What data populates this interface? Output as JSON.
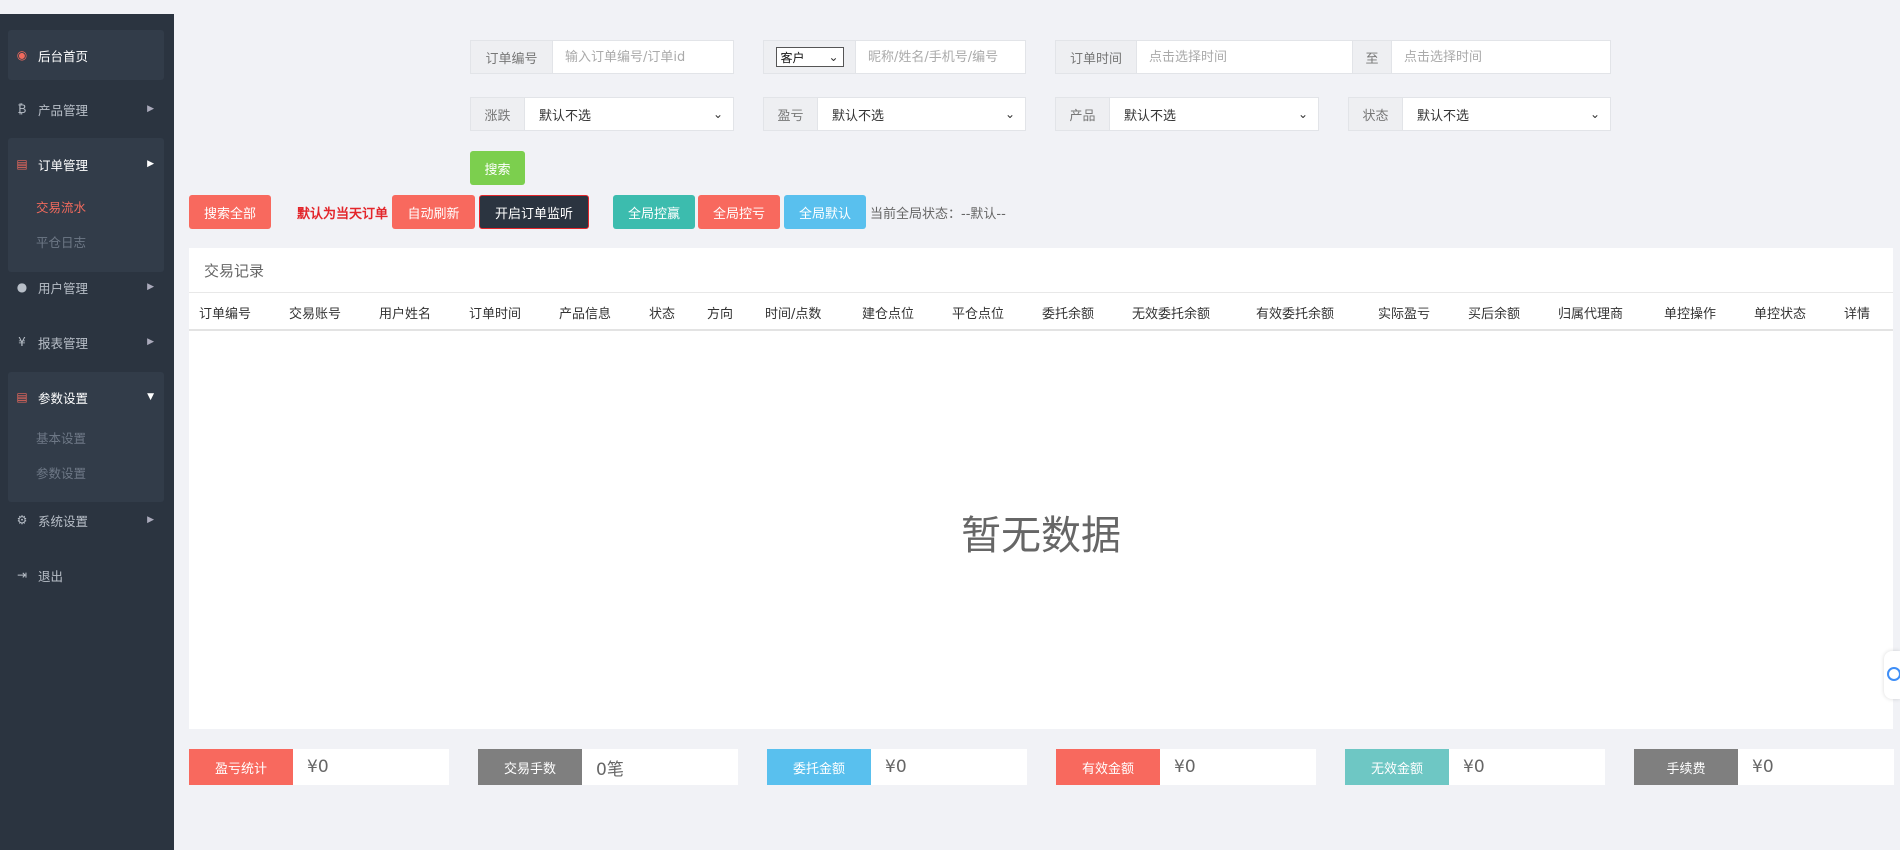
{
  "sidebar": {
    "items": [
      {
        "label": "后台首页",
        "icon": "dashboard-icon"
      },
      {
        "label": "产品管理",
        "icon": "bitcoin-icon"
      },
      {
        "label": "订单管理",
        "icon": "copy-icon"
      },
      {
        "label": "用户管理",
        "icon": "user-icon"
      },
      {
        "label": "报表管理",
        "icon": "yen-icon"
      },
      {
        "label": "参数设置",
        "icon": "copy-icon"
      },
      {
        "label": "系统设置",
        "icon": "gears-icon"
      },
      {
        "label": "退出",
        "icon": "sign-out-icon"
      }
    ],
    "order_sub": [
      "交易流水",
      "平仓日志"
    ],
    "param_sub": [
      "基本设置",
      "参数设置"
    ]
  },
  "filters": {
    "order_no": {
      "label": "订单编号",
      "placeholder": "输入订单编号/订单id"
    },
    "customer": {
      "select": "客户",
      "placeholder": "昵称/姓名/手机号/编号"
    },
    "order_time": {
      "label": "订单时间",
      "placeholder_from": "点击选择时间",
      "to": "至",
      "placeholder_to": "点击选择时间"
    },
    "rise_fall": {
      "label": "涨跌",
      "value": "默认不选"
    },
    "profit_loss": {
      "label": "盈亏",
      "value": "默认不选"
    },
    "product": {
      "label": "产品",
      "value": "默认不选"
    },
    "status": {
      "label": "状态",
      "value": "默认不选"
    },
    "search_button": "搜索"
  },
  "toolbar": {
    "search_all": "搜索全部",
    "default_today": "默认为当天订单",
    "auto_refresh": "自动刷新",
    "open_monitor": "开启订单监听",
    "global_win": "全局控赢",
    "global_loss": "全局控亏",
    "global_default": "全局默认",
    "global_status": "当前全局状态：--默认--"
  },
  "table": {
    "title": "交易记录",
    "columns": [
      "订单编号",
      "交易账号",
      "用户姓名",
      "订单时间",
      "产品信息",
      "状态",
      "方向",
      "时间/点数",
      "建仓点位",
      "平仓点位",
      "委托余额",
      "无效委托余额",
      "有效委托余额",
      "实际盈亏",
      "买后余额",
      "归属代理商",
      "单控操作",
      "单控状态",
      "详情"
    ],
    "empty_text": "暂无数据"
  },
  "stats": [
    {
      "label": "盈亏统计",
      "value": "¥0",
      "color": "#f8695e"
    },
    {
      "label": "交易手数",
      "value": "0笔",
      "color": "#7f7f7f"
    },
    {
      "label": "委托金额",
      "value": "¥0",
      "color": "#59c0ee"
    },
    {
      "label": "有效金额",
      "value": "¥0",
      "color": "#f8695e"
    },
    {
      "label": "无效金额",
      "value": "¥0",
      "color": "#6ec7c4"
    },
    {
      "label": "手续费",
      "value": "¥0",
      "color": "#7f7f7f"
    }
  ],
  "colors": {
    "sidebar_bg": "#2b3440",
    "accent_red": "#f8695e",
    "green": "#7ccf4e",
    "teal": "#3cbcae",
    "sky": "#59c0ee",
    "dark": "#2b3440"
  }
}
